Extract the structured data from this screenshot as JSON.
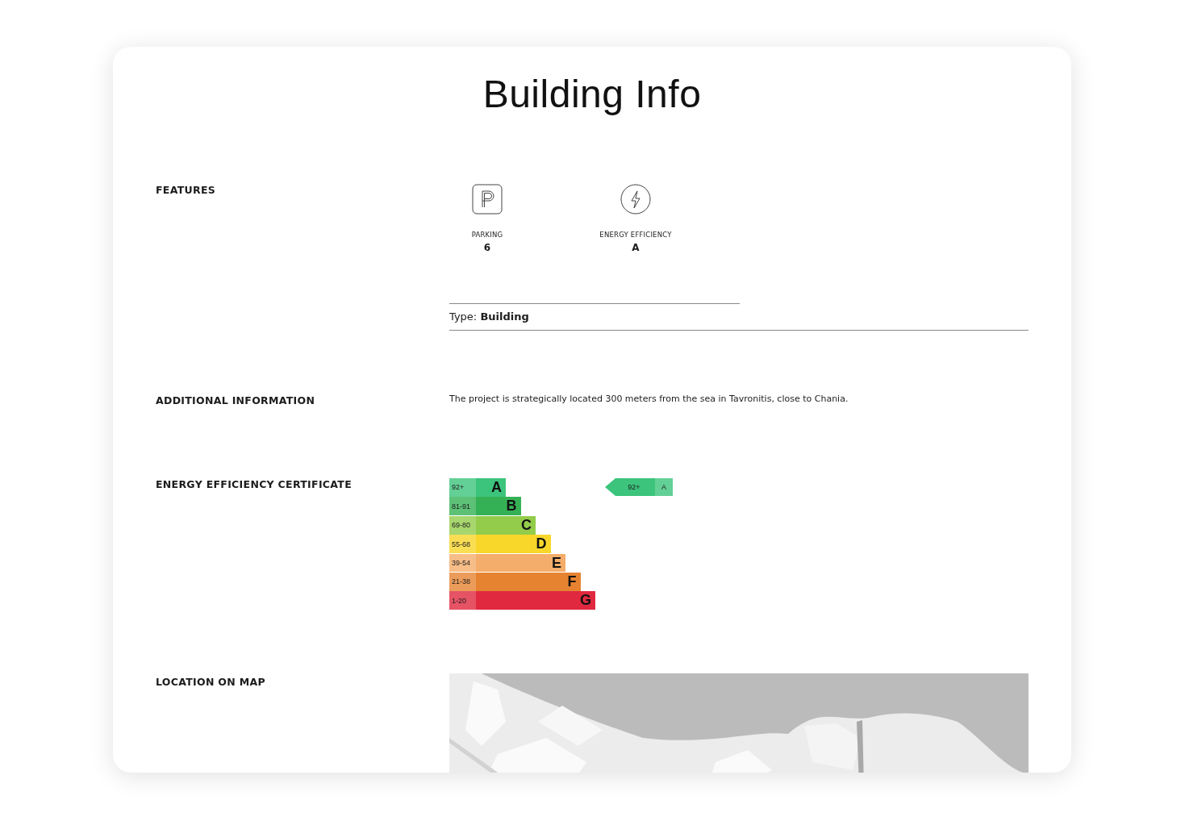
{
  "title": "Building Info",
  "features": {
    "label": "FEATURES",
    "items": [
      {
        "kind": "parking",
        "label": "PARKING",
        "value": "6"
      },
      {
        "kind": "energy",
        "label": "ENERGY EFFICIENCY",
        "value": "A"
      }
    ],
    "type_line": "Type: **Building**"
  },
  "additional_information": {
    "label": "ADDITIONAL INFORMATION",
    "text": "The project is strategically located 300 meters from the sea in Tavronitis, close to Chania."
  },
  "energy_certificate": {
    "label": "ENERGY EFFICIENCY CERTIFICATE",
    "bands": [
      {
        "range": "92+",
        "letter": "A",
        "color": "#3cc47c"
      },
      {
        "range": "81-91",
        "letter": "B",
        "color": "#35b155"
      },
      {
        "range": "69-80",
        "letter": "C",
        "color": "#92cc4a"
      },
      {
        "range": "55-68",
        "letter": "D",
        "color": "#f8d62a"
      },
      {
        "range": "39-54",
        "letter": "E",
        "color": "#f4ad6a"
      },
      {
        "range": "21-38",
        "letter": "F",
        "color": "#e68331"
      },
      {
        "range": "1-20",
        "letter": "G",
        "color": "#e0283f"
      }
    ],
    "rating": {
      "range": "92+",
      "letter": "A",
      "color": "#3cc47c"
    }
  },
  "location": {
    "label": "LOCATION ON MAP"
  }
}
